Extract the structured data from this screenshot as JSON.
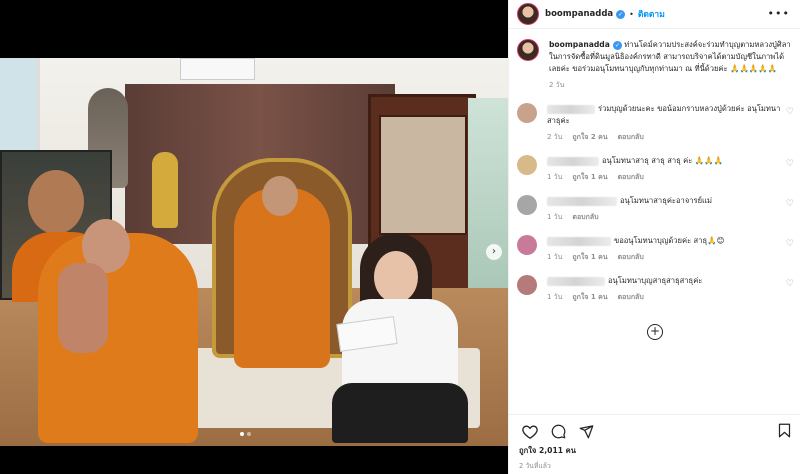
{
  "post": {
    "username": "boompanadda",
    "follow_label": "ติดตาม",
    "more_label": "•••",
    "caption_text": "ท่านโดม์ความประสงค์จะร่วมทำบุญตามหลวงปู่ศิลา ในการจัดซื้อที่ดินมูลนิธิองค์กรทาดี สามารถบริจาคได้ตามบัญชีในภาพได้เลยค่ะ ขอร่วมอนุโมทนาบุญกับทุกท่านมา ณ ที่นี้ด้วยค่ะ 🙏🙏🙏🙏🙏",
    "caption_time": "2 วัน",
    "likes": "ถูกใจ 2,011 คน",
    "date": "2 วันที่แล้ว"
  },
  "comments": [
    {
      "text": "ร่วมบุญด้วยนะคะ ขอน้อมกราบหลวงปู่ด้วยค่ะ อนุโมทนาสาธุค่ะ",
      "time": "2 วัน",
      "likes": "ถูกใจ 2 คน",
      "reply": "ตอบกลับ",
      "color": "#c9a28c"
    },
    {
      "text": "อนุโมทนาสาธุ สาธุ สาธุ ค่ะ 🙏🙏🙏",
      "time": "1 วัน",
      "likes": "ถูกใจ 1 คน",
      "reply": "ตอบกลับ",
      "color": "#d8b98a"
    },
    {
      "text": "อนุโมทนาสาธุค่ะอาจารย์แม่",
      "time": "1 วัน",
      "likes": "",
      "reply": "ตอบกลับ",
      "color": "#a6a6a6"
    },
    {
      "text": "ขออนุโมทนาบุญด้วยค่ะ สาธุ🙏😊",
      "time": "1 วัน",
      "likes": "ถูกใจ 1 คน",
      "reply": "ตอบกลับ",
      "color": "#c97a9a"
    },
    {
      "text": "อนุโมทนาบุญสาธุสาธุสาธุค่ะ",
      "time": "1 วัน",
      "likes": "ถูกใจ 1 คน",
      "reply": "ตอบกลับ",
      "color": "#b57a7a"
    }
  ],
  "icons": {
    "heart": "heart-icon",
    "comment": "comment-icon",
    "share": "share-icon",
    "save": "bookmark-icon",
    "load_more": "plus-circle-icon"
  }
}
